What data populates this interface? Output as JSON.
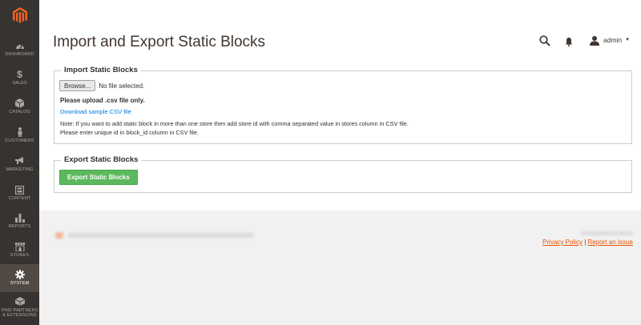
{
  "sidebar": {
    "items": [
      {
        "label": "DASHBOARD",
        "icon": "dashboard-icon"
      },
      {
        "label": "SALES",
        "icon": "dollar-icon"
      },
      {
        "label": "CATALOG",
        "icon": "cube-icon"
      },
      {
        "label": "CUSTOMERS",
        "icon": "person-icon"
      },
      {
        "label": "MARKETING",
        "icon": "megaphone-icon"
      },
      {
        "label": "CONTENT",
        "icon": "content-icon"
      },
      {
        "label": "REPORTS",
        "icon": "bar-chart-icon"
      },
      {
        "label": "STORES",
        "icon": "store-icon"
      },
      {
        "label": "SYSTEM",
        "icon": "gear-icon"
      },
      {
        "label_line1": "FIND PARTNERS",
        "label_line2": "& EXTENSIONS",
        "icon": "partners-icon"
      }
    ],
    "active": "SYSTEM",
    "logo": "magento-logo-icon"
  },
  "header": {
    "title": "Import and Export Static Blocks",
    "user": "admin"
  },
  "import": {
    "legend": "Import Static Blocks",
    "browse_label": "Browse...",
    "file_status": "No file selected.",
    "upload_note": "Please upload .csv file only.",
    "sample_link": "Download sample CSV file",
    "note_line1": "Note: If you want to add static block in more than one store then add store id with comma separated value in stores column in CSV file.",
    "note_line2": "Please enter unique id in block_id column in CSV file."
  },
  "export": {
    "legend": "Export Static Blocks",
    "button_label": "Export Static Blocks"
  },
  "footer": {
    "privacy": "Privacy Policy",
    "separator": "|",
    "report": "Report an Issue"
  },
  "colors": {
    "sidebar_bg": "#373330",
    "sidebar_active": "#514943",
    "accent": "#eb5202",
    "button_green": "#5cb85c",
    "link_blue": "#007bdb"
  }
}
